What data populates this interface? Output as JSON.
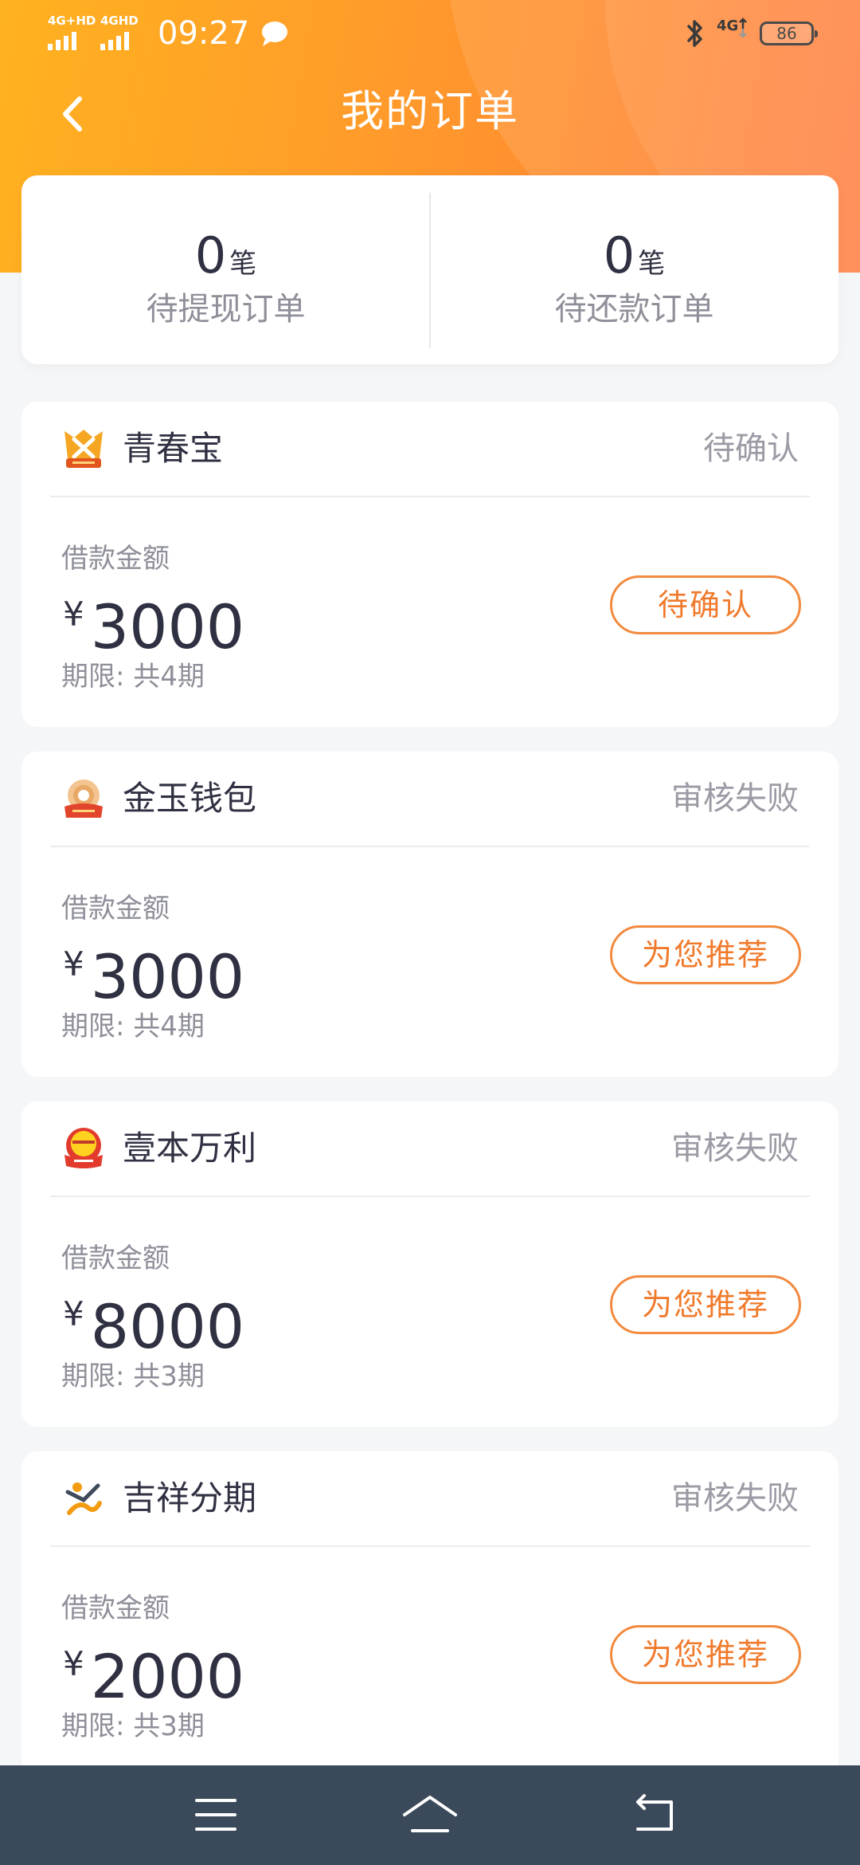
{
  "status_bar": {
    "network_1": "4G+HD",
    "network_2": "4GHD",
    "time": "09:27",
    "right_network": "4G",
    "battery": "86"
  },
  "header": {
    "title": "我的订单"
  },
  "summary": {
    "pending_withdraw": {
      "count": "0",
      "unit": "笔",
      "label": "待提现订单"
    },
    "pending_repay": {
      "count": "0",
      "unit": "笔",
      "label": "待还款订单"
    }
  },
  "orders": [
    {
      "name": "青春宝",
      "status": "待确认",
      "amount_label": "借款金额",
      "currency": "¥",
      "amount": "3000",
      "term": "期限: 共4期",
      "action": "待确认",
      "logo_icon": "qingchunbao-logo-icon"
    },
    {
      "name": "金玉钱包",
      "status": "审核失败",
      "amount_label": "借款金额",
      "currency": "¥",
      "amount": "3000",
      "term": "期限: 共4期",
      "action": "为您推荐",
      "logo_icon": "jinyu-wallet-logo-icon"
    },
    {
      "name": "壹本万利",
      "status": "审核失败",
      "amount_label": "借款金额",
      "currency": "¥",
      "amount": "8000",
      "term": "期限: 共3期",
      "action": "为您推荐",
      "logo_icon": "yibenwanli-logo-icon"
    },
    {
      "name": "吉祥分期",
      "status": "审核失败",
      "amount_label": "借款金额",
      "currency": "¥",
      "amount": "2000",
      "term": "期限: 共3期",
      "action": "为您推荐",
      "logo_icon": "jixiang-logo-icon"
    }
  ],
  "colors": {
    "header_start": "#ffb21f",
    "header_end": "#ff7a3a",
    "accent": "#f07a2c",
    "text_primary": "#2f3041",
    "text_secondary": "#8e8f99",
    "nav_bar": "#3b4a5a"
  },
  "icons": {
    "back": "chevron-left-icon",
    "chat": "chat-bubble-icon",
    "bluetooth": "bluetooth-icon",
    "menu": "menu-icon",
    "home": "home-icon",
    "return": "return-icon"
  }
}
